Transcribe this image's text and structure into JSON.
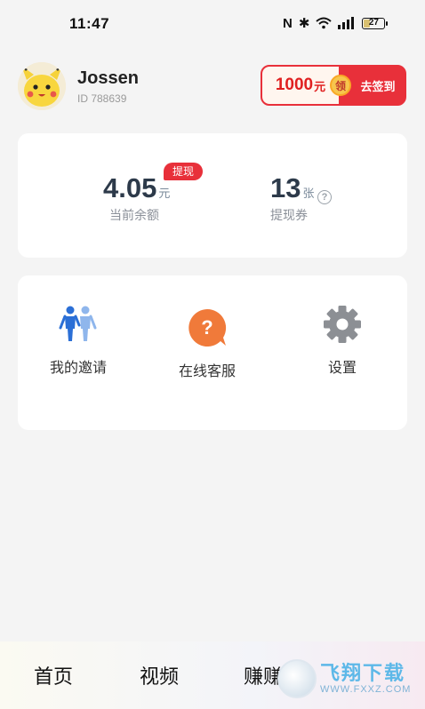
{
  "status_bar": {
    "time": "11:47",
    "nfc_glyph": "N",
    "bluetooth_glyph": "✱",
    "battery_level": "27",
    "battery_fraction": 0.27
  },
  "profile": {
    "username": "Jossen",
    "user_id": "ID  788639"
  },
  "signin": {
    "amount": "1000",
    "amount_unit": "元",
    "badge": "领",
    "action": "去签到"
  },
  "balance": {
    "value": "4.05",
    "unit": "元",
    "label": "当前余额",
    "withdraw_tag": "提现"
  },
  "coupons": {
    "value": "13",
    "unit": "张",
    "label": "提现券",
    "help_glyph": "?"
  },
  "menu": {
    "invite": "我的邀请",
    "service": "在线客服",
    "settings": "设置"
  },
  "tabs": {
    "home": "首页",
    "video": "视频",
    "earn": "赚赚"
  },
  "watermark": {
    "title": "飞翔下载",
    "url": "WWW.FXXZ.COM"
  },
  "colors": {
    "accent_red": "#e8303a",
    "service_orange": "#f07a3a",
    "invite_blue": "#2b6fd6"
  }
}
